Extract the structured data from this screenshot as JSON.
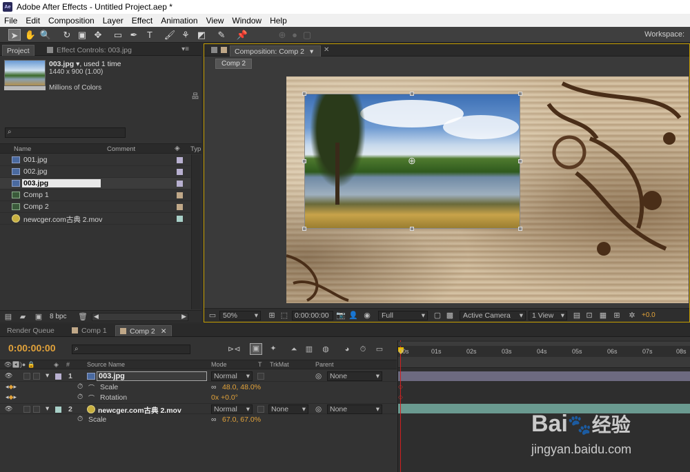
{
  "window": {
    "title": "Adobe After Effects - Untitled Project.aep *",
    "app_icon": "Ae"
  },
  "menu": [
    "File",
    "Edit",
    "Composition",
    "Layer",
    "Effect",
    "Animation",
    "View",
    "Window",
    "Help"
  ],
  "toolbar": {
    "workspace_label": "Workspace:"
  },
  "project_panel": {
    "tab_project": "Project",
    "tab_effect_controls": "Effect Controls: 003.jpg",
    "preview": {
      "name": "003.jpg",
      "usage": ", used 1 time",
      "dims": "1440 x 900 (1.00)",
      "colors": "Millions of Colors"
    },
    "search_placeholder": "",
    "columns": {
      "name": "Name",
      "comment": "Comment",
      "type": "Typ"
    },
    "items": [
      {
        "name": "001.jpg",
        "kind": "image",
        "color": "#b8b0d0"
      },
      {
        "name": "002.jpg",
        "kind": "image",
        "color": "#b8b0d0"
      },
      {
        "name": "003.jpg",
        "kind": "image",
        "color": "#b8b0d0",
        "selected": true
      },
      {
        "name": "Comp 1",
        "kind": "comp",
        "color": "#c0a888"
      },
      {
        "name": "Comp 2",
        "kind": "comp",
        "color": "#c0a888"
      },
      {
        "name": "newcger.com古典 2.mov",
        "kind": "movie",
        "color": "#a8d0c8"
      }
    ],
    "bpc": "8 bpc"
  },
  "comp_panel": {
    "tab": "Composition: Comp 2",
    "breadcrumb": "Comp 2",
    "zoom": "50%",
    "timecode": "0:00:00:00",
    "resolution": "Full",
    "camera": "Active Camera",
    "views": "1 View",
    "exposure": "+0.0"
  },
  "timeline": {
    "tabs": [
      "Render Queue",
      "Comp 1",
      "Comp 2"
    ],
    "timecode": "0:00:00:00",
    "columns": {
      "source_name": "Source Name",
      "mode": "Mode",
      "t": "T",
      "trkmat": "TrkMat",
      "parent": "Parent"
    },
    "ruler": [
      "00s",
      "01s",
      "02s",
      "03s",
      "04s",
      "05s",
      "06s",
      "07s",
      "08s"
    ],
    "layers": [
      {
        "num": "1",
        "name": "003.jpg",
        "mode": "Normal",
        "trkmat": "",
        "parent": "None",
        "color": "#b8b0d0",
        "props": [
          {
            "name": "Scale",
            "value": "48.0, 48.0%"
          },
          {
            "name": "Rotation",
            "value": "0x +0.0°"
          }
        ]
      },
      {
        "num": "2",
        "name": "newcger.com古典 2.mov",
        "mode": "Normal",
        "trkmat": "None",
        "parent": "None",
        "color": "#a8d0c8",
        "props": [
          {
            "name": "Scale",
            "value": "67.0, 67.0%"
          }
        ]
      }
    ]
  },
  "watermark": {
    "brand": "Bai",
    "brand2": "经验",
    "url": "jingyan.baidu.com"
  }
}
